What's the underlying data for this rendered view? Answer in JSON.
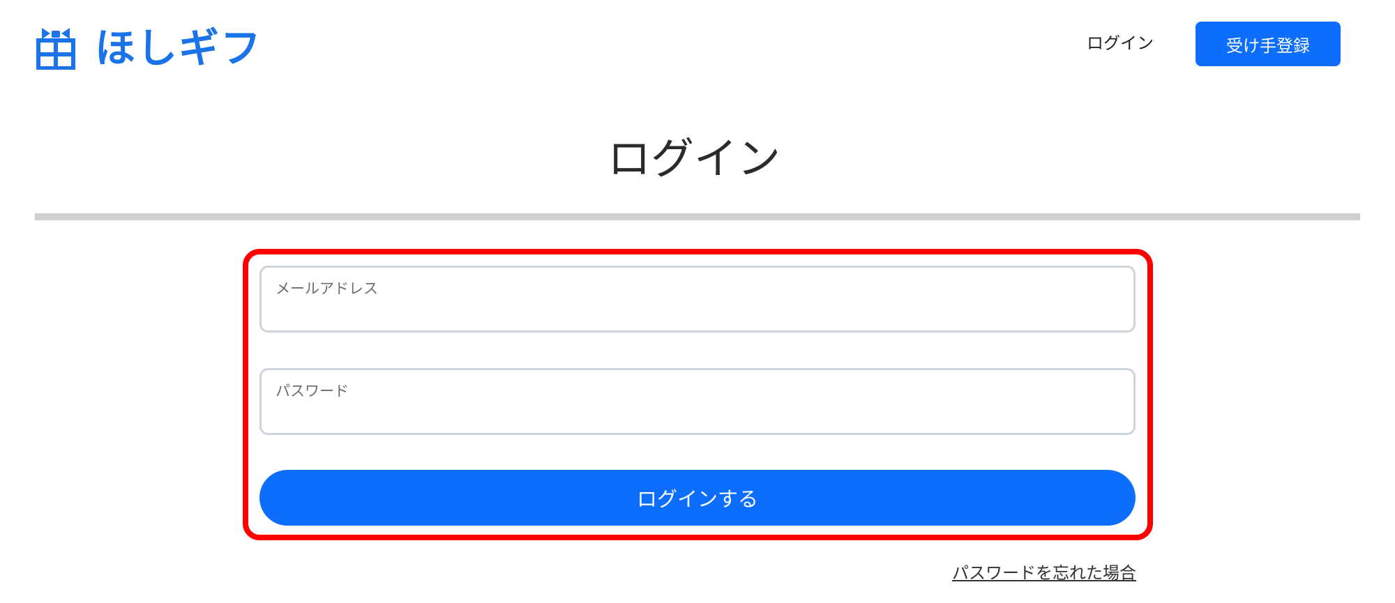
{
  "header": {
    "logo_text": "ほしギフ",
    "nav_login": "ログイン",
    "nav_register": "受け手登録"
  },
  "main": {
    "title": "ログイン",
    "form": {
      "email_label": "メールアドレス",
      "email_value": "",
      "password_label": "パスワード",
      "password_value": "",
      "submit_label": "ログインする"
    },
    "forgot_password": "パスワードを忘れた場合"
  },
  "colors": {
    "brand": "#1a73e8",
    "primary_button": "#0d6efd",
    "highlight": "#ff0000",
    "divider": "#d0d0d0"
  }
}
